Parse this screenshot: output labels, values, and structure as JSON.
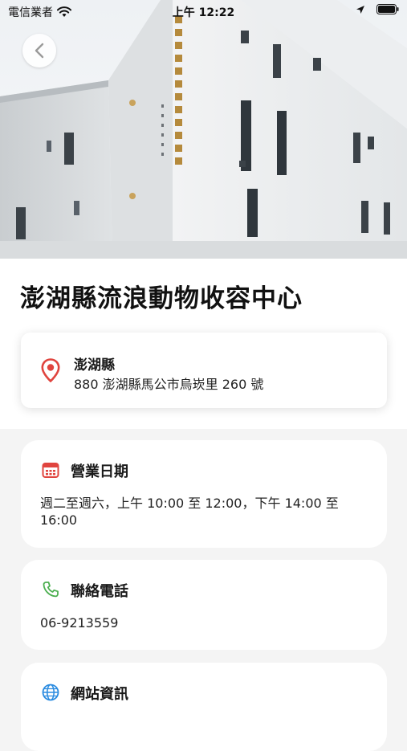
{
  "status_bar": {
    "carrier": "電信業者",
    "time": "上午 12:22"
  },
  "place": {
    "title": "澎湖縣流浪動物收容中心",
    "county": "澎湖縣",
    "address": "880 澎湖縣馬公市烏崁里 260 號"
  },
  "sections": {
    "hours": {
      "title": "營業日期",
      "body": "週二至週六，上午 10:00 至 12:00，下午 14:00 至 16:00"
    },
    "phone": {
      "title": "聯絡電話",
      "body": "06-9213559"
    },
    "website": {
      "title": "網站資訊",
      "body": ""
    }
  },
  "icons": {
    "back": "chevron-left-icon",
    "pin": "location-pin-icon",
    "calendar": "calendar-icon",
    "phone": "phone-icon",
    "web": "globe-icon"
  },
  "colors": {
    "accent_red": "#e0443e",
    "phone_green": "#4caf50",
    "globe_blue": "#2a8be0",
    "background": "#f4f4f4"
  }
}
